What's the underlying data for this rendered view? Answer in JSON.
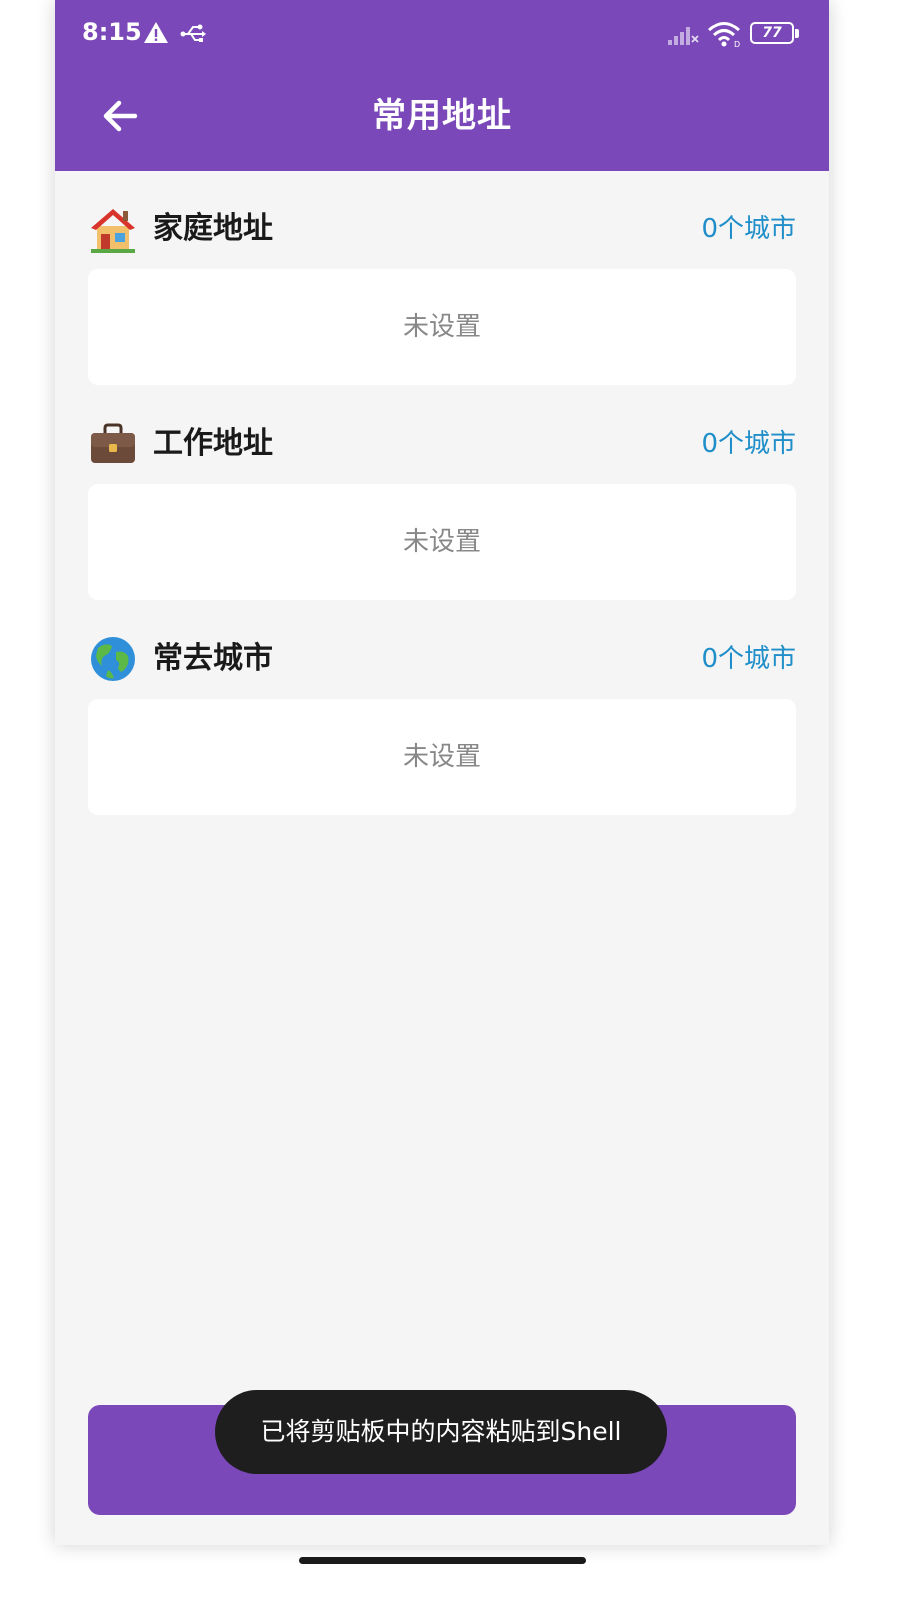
{
  "status_bar": {
    "time": "8:15",
    "battery_level": "77",
    "icons": [
      "warning-icon",
      "usb-debug-icon",
      "signal-icon",
      "wifi-icon",
      "battery-icon"
    ]
  },
  "header": {
    "title": "常用地址",
    "back_icon": "arrow-left-icon"
  },
  "sections": [
    {
      "icon": "house-icon",
      "title": "家庭地址",
      "count": "0个城市",
      "empty_text": "未设置"
    },
    {
      "icon": "briefcase-icon",
      "title": "工作地址",
      "count": "0个城市",
      "empty_text": "未设置"
    },
    {
      "icon": "globe-icon",
      "title": "常去城市",
      "count": "0个城市",
      "empty_text": "未设置"
    }
  ],
  "bottom_button": {
    "label": ""
  },
  "toast": {
    "text": "已将剪贴板中的内容粘贴到Shell"
  },
  "colors": {
    "primary": "#7a48b8",
    "accent_text": "#1f8ec9",
    "background": "#f5f5f5",
    "toast_bg": "#1e1e1e"
  }
}
